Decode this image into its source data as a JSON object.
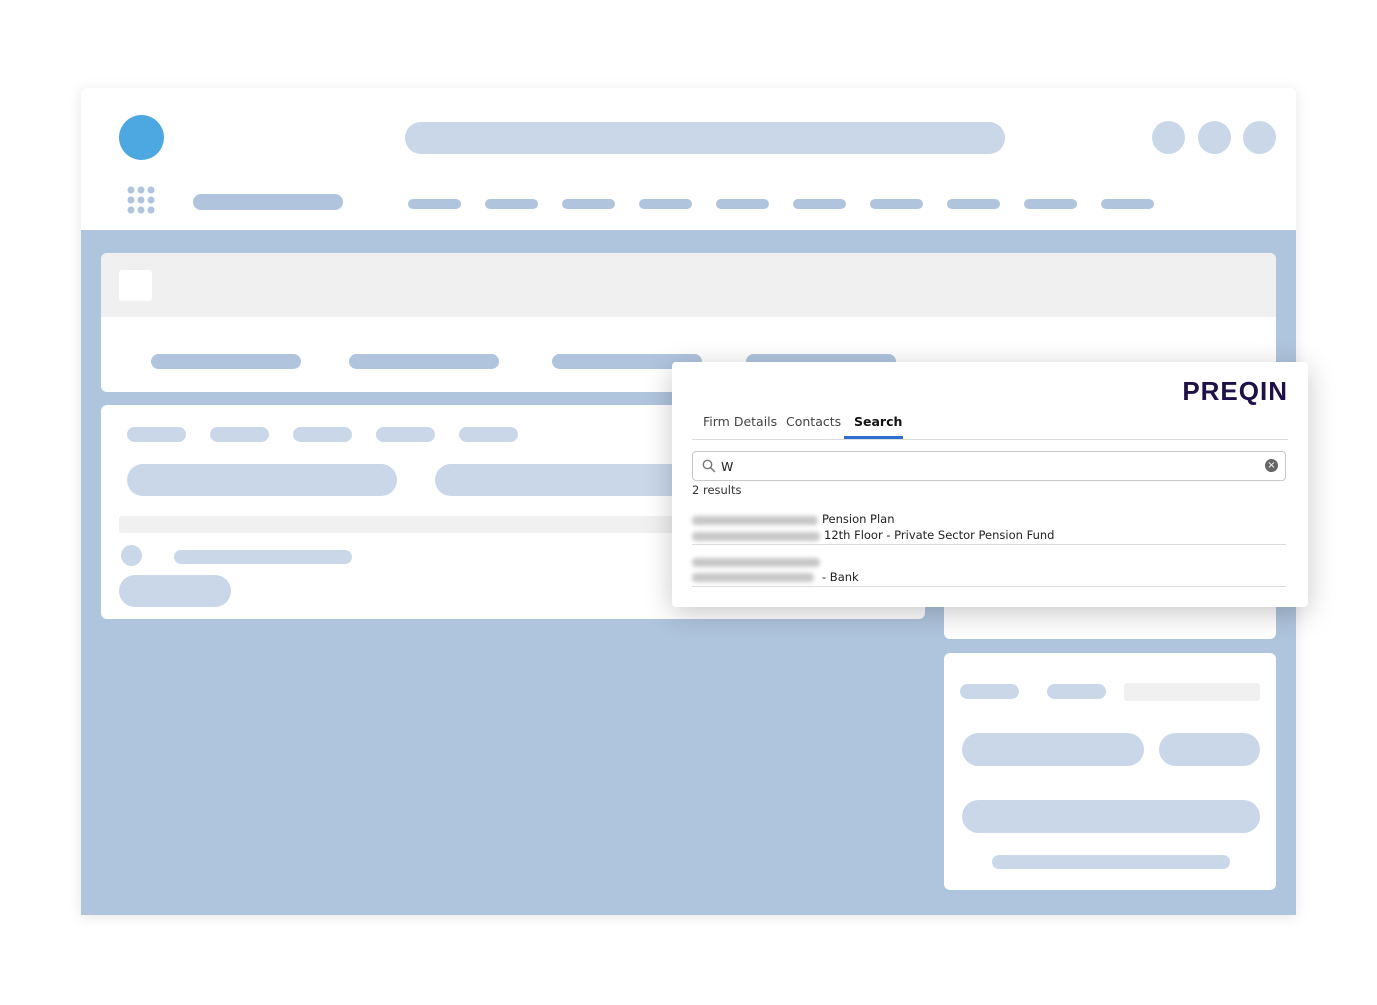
{
  "preqin": {
    "logo": "PREQIN",
    "tabs": [
      {
        "label": "Firm Details"
      },
      {
        "label": "Contacts"
      },
      {
        "label": "Search"
      }
    ],
    "active_tab": "Search",
    "search": {
      "value": "W"
    },
    "results_count": "2 results",
    "results": [
      {
        "line1_suffix": "Pension Plan",
        "line2_suffix": "12th Floor - Private Sector Pension Fund"
      },
      {
        "line2_suffix": "- Bank"
      }
    ]
  },
  "colors": {
    "window_background": "#afc4dd",
    "skeleton": "#c9d7e8",
    "avatar": "#4da8e2",
    "logo": "#1f1148",
    "active_tab_underline": "#2d6fd1"
  },
  "icons": [
    "app-launcher-icon",
    "search-icon",
    "clear-icon"
  ]
}
